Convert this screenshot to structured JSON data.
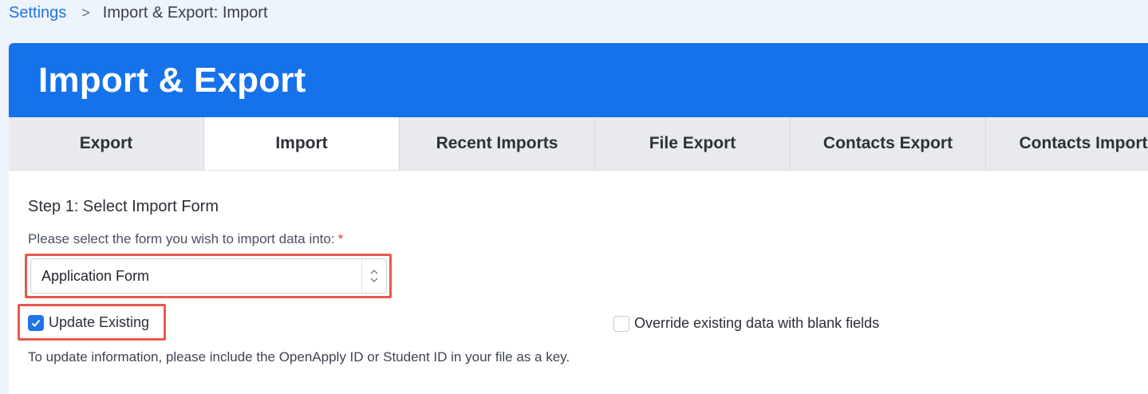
{
  "breadcrumb": {
    "parent": "Settings",
    "separator": ">",
    "current": "Import & Export: Import"
  },
  "header": {
    "title": "Import & Export"
  },
  "tabs": [
    {
      "label": "Export",
      "active": false
    },
    {
      "label": "Import",
      "active": true
    },
    {
      "label": "Recent Imports",
      "active": false
    },
    {
      "label": "File Export",
      "active": false
    },
    {
      "label": "Contacts Export",
      "active": false
    },
    {
      "label": "Contacts Import",
      "active": false
    }
  ],
  "step": {
    "title": "Step 1: Select Import Form",
    "select_label": "Please select the form you wish to import data into:",
    "required_marker": "*",
    "select_value": "Application Form"
  },
  "options": {
    "update_existing": {
      "label": "Update Existing",
      "checked": true
    },
    "override_blank": {
      "label": "Override existing data with blank fields",
      "checked": false
    },
    "hint": "To update information, please include the OpenApply ID or Student ID in your file as a key."
  },
  "colors": {
    "accent": "#1672ea",
    "highlight": "#e8584c",
    "required": "#e0413b"
  },
  "icons": {
    "breadcrumb_separator": "chevron-right-icon",
    "select_arrows": "up-down-arrows-icon",
    "checkbox_check": "checkmark-icon"
  }
}
